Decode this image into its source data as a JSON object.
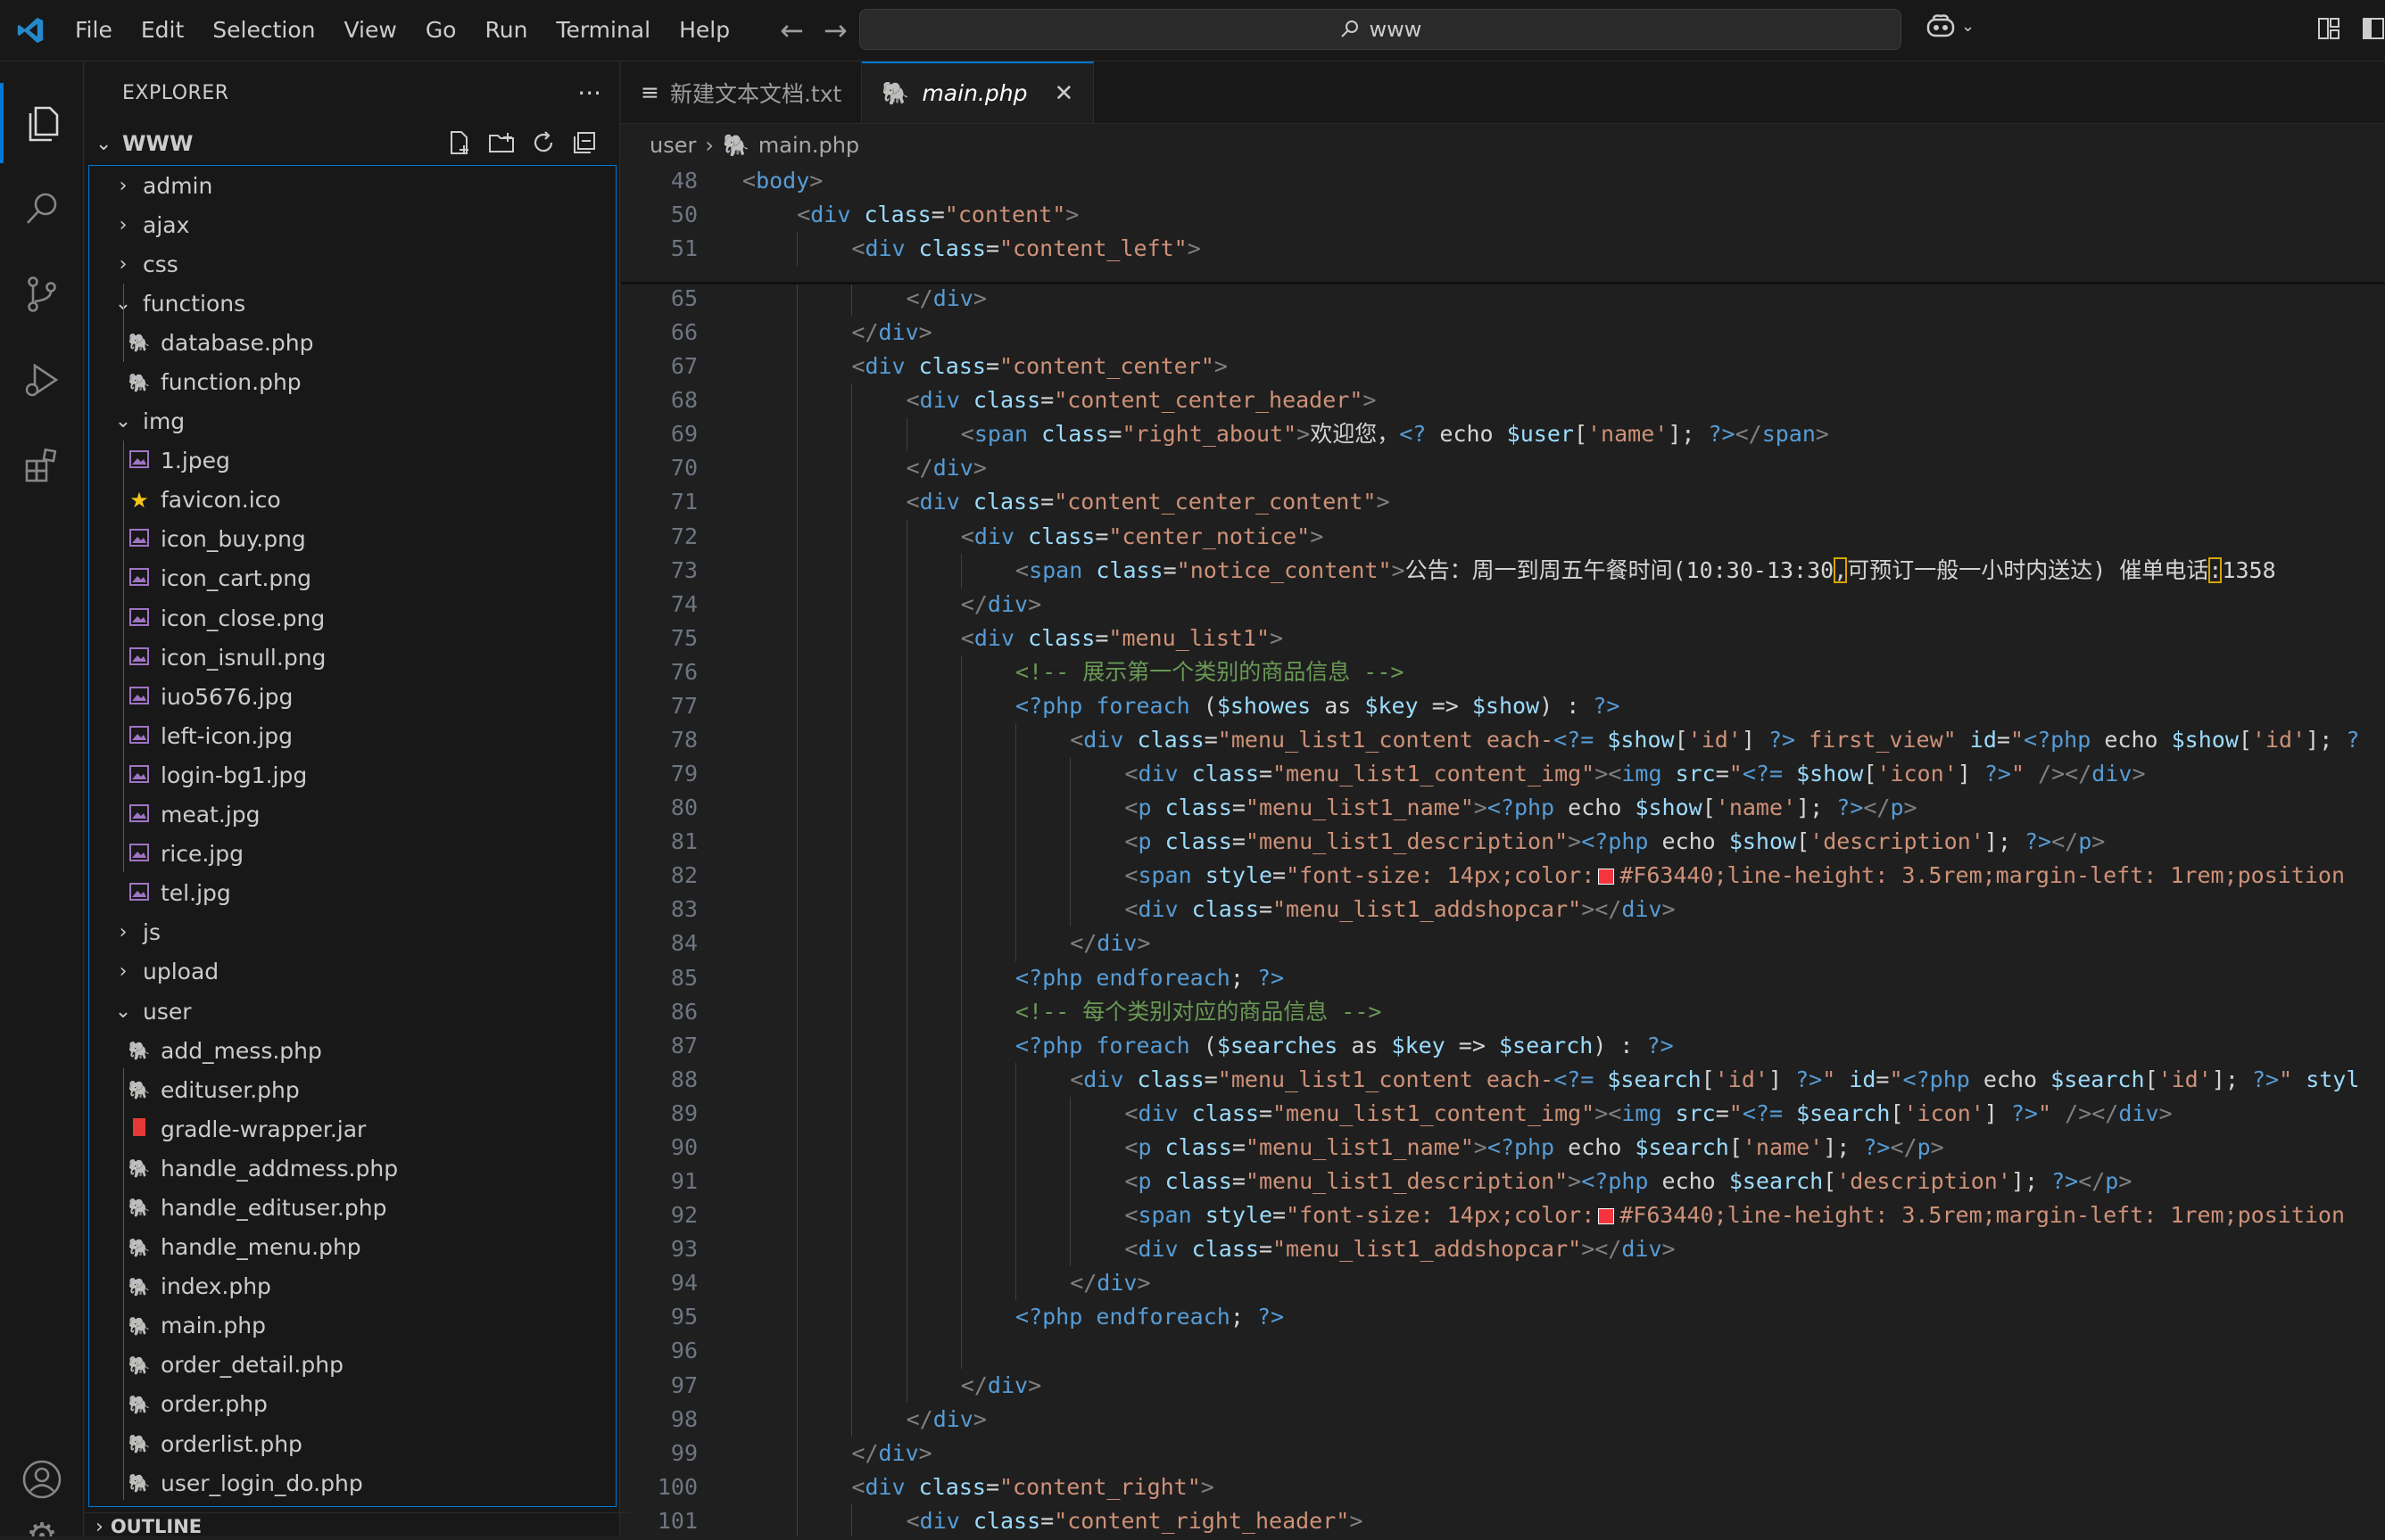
{
  "titlebar": {
    "menu": [
      "File",
      "Edit",
      "Selection",
      "View",
      "Go",
      "Run",
      "Terminal",
      "Help"
    ],
    "search_text": "www"
  },
  "sidebar": {
    "header": "EXPLORER",
    "more": "···",
    "root": "WWW",
    "tree": [
      {
        "label": "admin",
        "depth": 0,
        "type": "folder",
        "open": false
      },
      {
        "label": "ajax",
        "depth": 0,
        "type": "folder",
        "open": false
      },
      {
        "label": "css",
        "depth": 0,
        "type": "folder",
        "open": false
      },
      {
        "label": "functions",
        "depth": 0,
        "type": "folder",
        "open": true
      },
      {
        "label": "database.php",
        "depth": 1,
        "type": "php"
      },
      {
        "label": "function.php",
        "depth": 1,
        "type": "php"
      },
      {
        "label": "img",
        "depth": 0,
        "type": "folder",
        "open": true
      },
      {
        "label": "1.jpeg",
        "depth": 1,
        "type": "image"
      },
      {
        "label": "favicon.ico",
        "depth": 1,
        "type": "favicon"
      },
      {
        "label": "icon_buy.png",
        "depth": 1,
        "type": "image"
      },
      {
        "label": "icon_cart.png",
        "depth": 1,
        "type": "image"
      },
      {
        "label": "icon_close.png",
        "depth": 1,
        "type": "image"
      },
      {
        "label": "icon_isnull.png",
        "depth": 1,
        "type": "image"
      },
      {
        "label": "iuo5676.jpg",
        "depth": 1,
        "type": "image"
      },
      {
        "label": "left-icon.jpg",
        "depth": 1,
        "type": "image"
      },
      {
        "label": "login-bg1.jpg",
        "depth": 1,
        "type": "image"
      },
      {
        "label": "meat.jpg",
        "depth": 1,
        "type": "image"
      },
      {
        "label": "rice.jpg",
        "depth": 1,
        "type": "image"
      },
      {
        "label": "tel.jpg",
        "depth": 1,
        "type": "image"
      },
      {
        "label": "js",
        "depth": 0,
        "type": "folder",
        "open": false
      },
      {
        "label": "upload",
        "depth": 0,
        "type": "folder",
        "open": false
      },
      {
        "label": "user",
        "depth": 0,
        "type": "folder",
        "open": true
      },
      {
        "label": "add_mess.php",
        "depth": 1,
        "type": "php"
      },
      {
        "label": "edituser.php",
        "depth": 1,
        "type": "php"
      },
      {
        "label": "gradle-wrapper.jar",
        "depth": 1,
        "type": "jar"
      },
      {
        "label": "handle_addmess.php",
        "depth": 1,
        "type": "php"
      },
      {
        "label": "handle_edituser.php",
        "depth": 1,
        "type": "php"
      },
      {
        "label": "handle_menu.php",
        "depth": 1,
        "type": "php"
      },
      {
        "label": "index.php",
        "depth": 1,
        "type": "php"
      },
      {
        "label": "main.php",
        "depth": 1,
        "type": "php"
      },
      {
        "label": "order_detail.php",
        "depth": 1,
        "type": "php"
      },
      {
        "label": "order.php",
        "depth": 1,
        "type": "php"
      },
      {
        "label": "orderlist.php",
        "depth": 1,
        "type": "php"
      },
      {
        "label": "user_login_do.php",
        "depth": 1,
        "type": "php"
      }
    ],
    "outline": "OUTLINE"
  },
  "tabs": [
    {
      "label": "新建文本文档.txt",
      "active": false,
      "icon": "text-lines-icon"
    },
    {
      "label": "main.php",
      "active": true,
      "icon": "php-elephant-icon"
    }
  ],
  "breadcrumb": {
    "folder": "user",
    "file": "main.php"
  },
  "sticky": [
    {
      "no": "48",
      "indent": 1,
      "html": "<span class=\"tg\">&lt;</span><span class=\"tn\">body</span><span class=\"tg\">&gt;</span>"
    },
    {
      "no": "50",
      "indent": 2,
      "html": "<span class=\"tg\">&lt;</span><span class=\"tn\">div</span> <span class=\"an\">class</span><span class=\"tx\">=</span><span class=\"sv\">\"content\"</span><span class=\"tg\">&gt;</span>"
    },
    {
      "no": "51",
      "indent": 3,
      "html": "<span class=\"tg\">&lt;</span><span class=\"tn\">div</span> <span class=\"an\">class</span><span class=\"tx\">=</span><span class=\"sv\">\"content_left\"</span><span class=\"tg\">&gt;</span>"
    }
  ],
  "code": [
    {
      "no": "65",
      "indent": 4,
      "html": "<span class=\"tg\">&lt;/</span><span class=\"tn\">div</span><span class=\"tg\">&gt;</span>"
    },
    {
      "no": "66",
      "indent": 3,
      "html": "<span class=\"tg\">&lt;/</span><span class=\"tn\">div</span><span class=\"tg\">&gt;</span>"
    },
    {
      "no": "67",
      "indent": 3,
      "html": "<span class=\"tg\">&lt;</span><span class=\"tn\">div</span> <span class=\"an\">class</span><span class=\"tx\">=</span><span class=\"sv\">\"content_center\"</span><span class=\"tg\">&gt;</span>"
    },
    {
      "no": "68",
      "indent": 4,
      "html": "<span class=\"tg\">&lt;</span><span class=\"tn\">div</span> <span class=\"an\">class</span><span class=\"tx\">=</span><span class=\"sv\">\"content_center_header\"</span><span class=\"tg\">&gt;</span>"
    },
    {
      "no": "69",
      "indent": 5,
      "html": "<span class=\"tg\">&lt;</span><span class=\"tn\">span</span> <span class=\"an\">class</span><span class=\"tx\">=</span><span class=\"sv\">\"right_about\"</span><span class=\"tg\">&gt;</span><span class=\"tx\">欢迎您，</span><span class=\"ph\">&lt;?</span> <span class=\"tx\">echo</span> <span class=\"vr\">$user</span><span class=\"tx\">[</span><span class=\"sv\">'name'</span><span class=\"tx\">];</span> <span class=\"ph\">?&gt;</span><span class=\"tg\">&lt;/</span><span class=\"tn\">span</span><span class=\"tg\">&gt;</span>"
    },
    {
      "no": "70",
      "indent": 4,
      "html": "<span class=\"tg\">&lt;/</span><span class=\"tn\">div</span><span class=\"tg\">&gt;</span>"
    },
    {
      "no": "71",
      "indent": 4,
      "html": "<span class=\"tg\">&lt;</span><span class=\"tn\">div</span> <span class=\"an\">class</span><span class=\"tx\">=</span><span class=\"sv\">\"content_center_content\"</span><span class=\"tg\">&gt;</span>"
    },
    {
      "no": "72",
      "indent": 5,
      "html": "<span class=\"tg\">&lt;</span><span class=\"tn\">div</span> <span class=\"an\">class</span><span class=\"tx\">=</span><span class=\"sv\">\"center_notice\"</span><span class=\"tg\">&gt;</span>"
    },
    {
      "no": "73",
      "indent": 6,
      "html": "<span class=\"tg\">&lt;</span><span class=\"tn\">span</span> <span class=\"an\">class</span><span class=\"tx\">=</span><span class=\"sv\">\"notice_content\"</span><span class=\"tg\">&gt;</span><span class=\"tx\">公告：周一到周五午餐时间(10:30-13:30</span><span class=\"tx hl\">,</span><span class=\"tx\">可预订一般一小时内送达) 催单电话</span><span class=\"tx hl\">:</span><span class=\"tx\">1358</span>"
    },
    {
      "no": "74",
      "indent": 5,
      "html": "<span class=\"tg\">&lt;/</span><span class=\"tn\">div</span><span class=\"tg\">&gt;</span>"
    },
    {
      "no": "75",
      "indent": 5,
      "html": "<span class=\"tg\">&lt;</span><span class=\"tn\">div</span> <span class=\"an\">class</span><span class=\"tx\">=</span><span class=\"sv\">\"menu_list1\"</span><span class=\"tg\">&gt;</span>"
    },
    {
      "no": "76",
      "indent": 6,
      "html": "<span class=\"cm\">&lt;!-- 展示第一个类别的商品信息 --&gt;</span>"
    },
    {
      "no": "77",
      "indent": 6,
      "html": "<span class=\"ph\">&lt;?php</span> <span class=\"kw\">foreach</span> <span class=\"tx\">(</span><span class=\"vr\">$showes</span> <span class=\"tx\">as</span> <span class=\"vr\">$key</span> <span class=\"tx\">=&gt;</span> <span class=\"vr\">$show</span><span class=\"tx\">) :</span> <span class=\"ph\">?&gt;</span>"
    },
    {
      "no": "78",
      "indent": 7,
      "html": "<span class=\"tg\">&lt;</span><span class=\"tn\">div</span> <span class=\"an\">class</span><span class=\"tx\">=</span><span class=\"sv\">\"menu_list1_content each-</span><span class=\"ph\">&lt;?=</span> <span class=\"vr\">$show</span><span class=\"tx\">[</span><span class=\"sv\">'id'</span><span class=\"tx\">]</span> <span class=\"ph\">?&gt;</span><span class=\"sv\"> first_view\"</span> <span class=\"an\">id</span><span class=\"tx\">=</span><span class=\"sv\">\"</span><span class=\"ph\">&lt;?php</span> <span class=\"tx\">echo</span> <span class=\"vr\">$show</span><span class=\"tx\">[</span><span class=\"sv\">'id'</span><span class=\"tx\">];</span> <span class=\"ph\">?</span>"
    },
    {
      "no": "79",
      "indent": 8,
      "html": "<span class=\"tg\">&lt;</span><span class=\"tn\">div</span> <span class=\"an\">class</span><span class=\"tx\">=</span><span class=\"sv\">\"menu_list1_content_img\"</span><span class=\"tg\">&gt;&lt;</span><span class=\"tn\">img</span> <span class=\"an\">src</span><span class=\"tx\">=</span><span class=\"sv\">\"</span><span class=\"ph\">&lt;?=</span> <span class=\"vr\">$show</span><span class=\"tx\">[</span><span class=\"sv\">'icon'</span><span class=\"tx\">]</span> <span class=\"ph\">?&gt;</span><span class=\"sv\">\"</span> <span class=\"tg\">/&gt;&lt;/</span><span class=\"tn\">div</span><span class=\"tg\">&gt;</span>"
    },
    {
      "no": "80",
      "indent": 8,
      "html": "<span class=\"tg\">&lt;</span><span class=\"tn\">p</span> <span class=\"an\">class</span><span class=\"tx\">=</span><span class=\"sv\">\"menu_list1_name\"</span><span class=\"tg\">&gt;</span><span class=\"ph\">&lt;?php</span> <span class=\"tx\">echo</span> <span class=\"vr\">$show</span><span class=\"tx\">[</span><span class=\"sv\">'name'</span><span class=\"tx\">];</span> <span class=\"ph\">?&gt;</span><span class=\"tg\">&lt;/</span><span class=\"tn\">p</span><span class=\"tg\">&gt;</span>"
    },
    {
      "no": "81",
      "indent": 8,
      "html": "<span class=\"tg\">&lt;</span><span class=\"tn\">p</span> <span class=\"an\">class</span><span class=\"tx\">=</span><span class=\"sv\">\"menu_list1_description\"</span><span class=\"tg\">&gt;</span><span class=\"ph\">&lt;?php</span> <span class=\"tx\">echo</span> <span class=\"vr\">$show</span><span class=\"tx\">[</span><span class=\"sv\">'description'</span><span class=\"tx\">];</span> <span class=\"ph\">?&gt;</span><span class=\"tg\">&lt;/</span><span class=\"tn\">p</span><span class=\"tg\">&gt;</span>"
    },
    {
      "no": "82",
      "indent": 8,
      "html": "<span class=\"tg\">&lt;</span><span class=\"tn\">span</span> <span class=\"an\">style</span><span class=\"tx\">=</span><span class=\"sv\">\"font-size: 14px;color:<span class=\"sw\"></span>#F63440;line-height: 3.5rem;margin-left: 1rem;position</span>"
    },
    {
      "no": "83",
      "indent": 8,
      "html": "<span class=\"tg\">&lt;</span><span class=\"tn\">div</span> <span class=\"an\">class</span><span class=\"tx\">=</span><span class=\"sv\">\"menu_list1_addshopcar\"</span><span class=\"tg\">&gt;&lt;/</span><span class=\"tn\">div</span><span class=\"tg\">&gt;</span>"
    },
    {
      "no": "84",
      "indent": 7,
      "html": "<span class=\"tg\">&lt;/</span><span class=\"tn\">div</span><span class=\"tg\">&gt;</span>"
    },
    {
      "no": "85",
      "indent": 6,
      "html": "<span class=\"ph\">&lt;?php</span> <span class=\"kw\">endforeach</span><span class=\"tx\">;</span> <span class=\"ph\">?&gt;</span>"
    },
    {
      "no": "86",
      "indent": 6,
      "html": "<span class=\"cm\">&lt;!-- 每个类别对应的商品信息 --&gt;</span>"
    },
    {
      "no": "87",
      "indent": 6,
      "html": "<span class=\"ph\">&lt;?php</span> <span class=\"kw\">foreach</span> <span class=\"tx\">(</span><span class=\"vr\">$searches</span> <span class=\"tx\">as</span> <span class=\"vr\">$key</span> <span class=\"tx\">=&gt;</span> <span class=\"vr\">$search</span><span class=\"tx\">) :</span> <span class=\"ph\">?&gt;</span>"
    },
    {
      "no": "88",
      "indent": 7,
      "html": "<span class=\"tg\">&lt;</span><span class=\"tn\">div</span> <span class=\"an\">class</span><span class=\"tx\">=</span><span class=\"sv\">\"menu_list1_content each-</span><span class=\"ph\">&lt;?=</span> <span class=\"vr\">$search</span><span class=\"tx\">[</span><span class=\"sv\">'id'</span><span class=\"tx\">]</span> <span class=\"ph\">?&gt;</span><span class=\"sv\">\"</span> <span class=\"an\">id</span><span class=\"tx\">=</span><span class=\"sv\">\"</span><span class=\"ph\">&lt;?php</span> <span class=\"tx\">echo</span> <span class=\"vr\">$search</span><span class=\"tx\">[</span><span class=\"sv\">'id'</span><span class=\"tx\">];</span> <span class=\"ph\">?&gt;</span><span class=\"sv\">\"</span> <span class=\"an\">styl</span>"
    },
    {
      "no": "89",
      "indent": 8,
      "html": "<span class=\"tg\">&lt;</span><span class=\"tn\">div</span> <span class=\"an\">class</span><span class=\"tx\">=</span><span class=\"sv\">\"menu_list1_content_img\"</span><span class=\"tg\">&gt;&lt;</span><span class=\"tn\">img</span> <span class=\"an\">src</span><span class=\"tx\">=</span><span class=\"sv\">\"</span><span class=\"ph\">&lt;?=</span> <span class=\"vr\">$search</span><span class=\"tx\">[</span><span class=\"sv\">'icon'</span><span class=\"tx\">]</span> <span class=\"ph\">?&gt;</span><span class=\"sv\">\"</span> <span class=\"tg\">/&gt;&lt;/</span><span class=\"tn\">div</span><span class=\"tg\">&gt;</span>"
    },
    {
      "no": "90",
      "indent": 8,
      "html": "<span class=\"tg\">&lt;</span><span class=\"tn\">p</span> <span class=\"an\">class</span><span class=\"tx\">=</span><span class=\"sv\">\"menu_list1_name\"</span><span class=\"tg\">&gt;</span><span class=\"ph\">&lt;?php</span> <span class=\"tx\">echo</span> <span class=\"vr\">$search</span><span class=\"tx\">[</span><span class=\"sv\">'name'</span><span class=\"tx\">];</span> <span class=\"ph\">?&gt;</span><span class=\"tg\">&lt;/</span><span class=\"tn\">p</span><span class=\"tg\">&gt;</span>"
    },
    {
      "no": "91",
      "indent": 8,
      "html": "<span class=\"tg\">&lt;</span><span class=\"tn\">p</span> <span class=\"an\">class</span><span class=\"tx\">=</span><span class=\"sv\">\"menu_list1_description\"</span><span class=\"tg\">&gt;</span><span class=\"ph\">&lt;?php</span> <span class=\"tx\">echo</span> <span class=\"vr\">$search</span><span class=\"tx\">[</span><span class=\"sv\">'description'</span><span class=\"tx\">];</span> <span class=\"ph\">?&gt;</span><span class=\"tg\">&lt;/</span><span class=\"tn\">p</span><span class=\"tg\">&gt;</span>"
    },
    {
      "no": "92",
      "indent": 8,
      "html": "<span class=\"tg\">&lt;</span><span class=\"tn\">span</span> <span class=\"an\">style</span><span class=\"tx\">=</span><span class=\"sv\">\"font-size: 14px;color:<span class=\"sw\"></span>#F63440;line-height: 3.5rem;margin-left: 1rem;position</span>"
    },
    {
      "no": "93",
      "indent": 8,
      "html": "<span class=\"tg\">&lt;</span><span class=\"tn\">div</span> <span class=\"an\">class</span><span class=\"tx\">=</span><span class=\"sv\">\"menu_list1_addshopcar\"</span><span class=\"tg\">&gt;&lt;/</span><span class=\"tn\">div</span><span class=\"tg\">&gt;</span>"
    },
    {
      "no": "94",
      "indent": 7,
      "html": "<span class=\"tg\">&lt;/</span><span class=\"tn\">div</span><span class=\"tg\">&gt;</span>"
    },
    {
      "no": "95",
      "indent": 6,
      "html": "<span class=\"ph\">&lt;?php</span> <span class=\"kw\">endforeach</span><span class=\"tx\">;</span> <span class=\"ph\">?&gt;</span>"
    },
    {
      "no": "96",
      "indent": 6,
      "html": ""
    },
    {
      "no": "97",
      "indent": 5,
      "html": "<span class=\"tg\">&lt;/</span><span class=\"tn\">div</span><span class=\"tg\">&gt;</span>"
    },
    {
      "no": "98",
      "indent": 4,
      "html": "<span class=\"tg\">&lt;/</span><span class=\"tn\">div</span><span class=\"tg\">&gt;</span>"
    },
    {
      "no": "99",
      "indent": 3,
      "html": "<span class=\"tg\">&lt;/</span><span class=\"tn\">div</span><span class=\"tg\">&gt;</span>"
    },
    {
      "no": "100",
      "indent": 3,
      "html": "<span class=\"tg\">&lt;</span><span class=\"tn\">div</span> <span class=\"an\">class</span><span class=\"tx\">=</span><span class=\"sv\">\"content_right\"</span><span class=\"tg\">&gt;</span>"
    },
    {
      "no": "101",
      "indent": 4,
      "html": "<span class=\"tg\">&lt;</span><span class=\"tn\">div</span> <span class=\"an\">class</span><span class=\"tx\">=</span><span class=\"sv\">\"content_right_header\"</span><span class=\"tg\">&gt;</span>"
    }
  ],
  "colors": {
    "accent": "#0078d4",
    "php_icon": "#a074c4",
    "image_icon": "#a074c4",
    "favicon": "#f5c518",
    "jar_icon": "#e53935",
    "swatch": "#F63440"
  }
}
